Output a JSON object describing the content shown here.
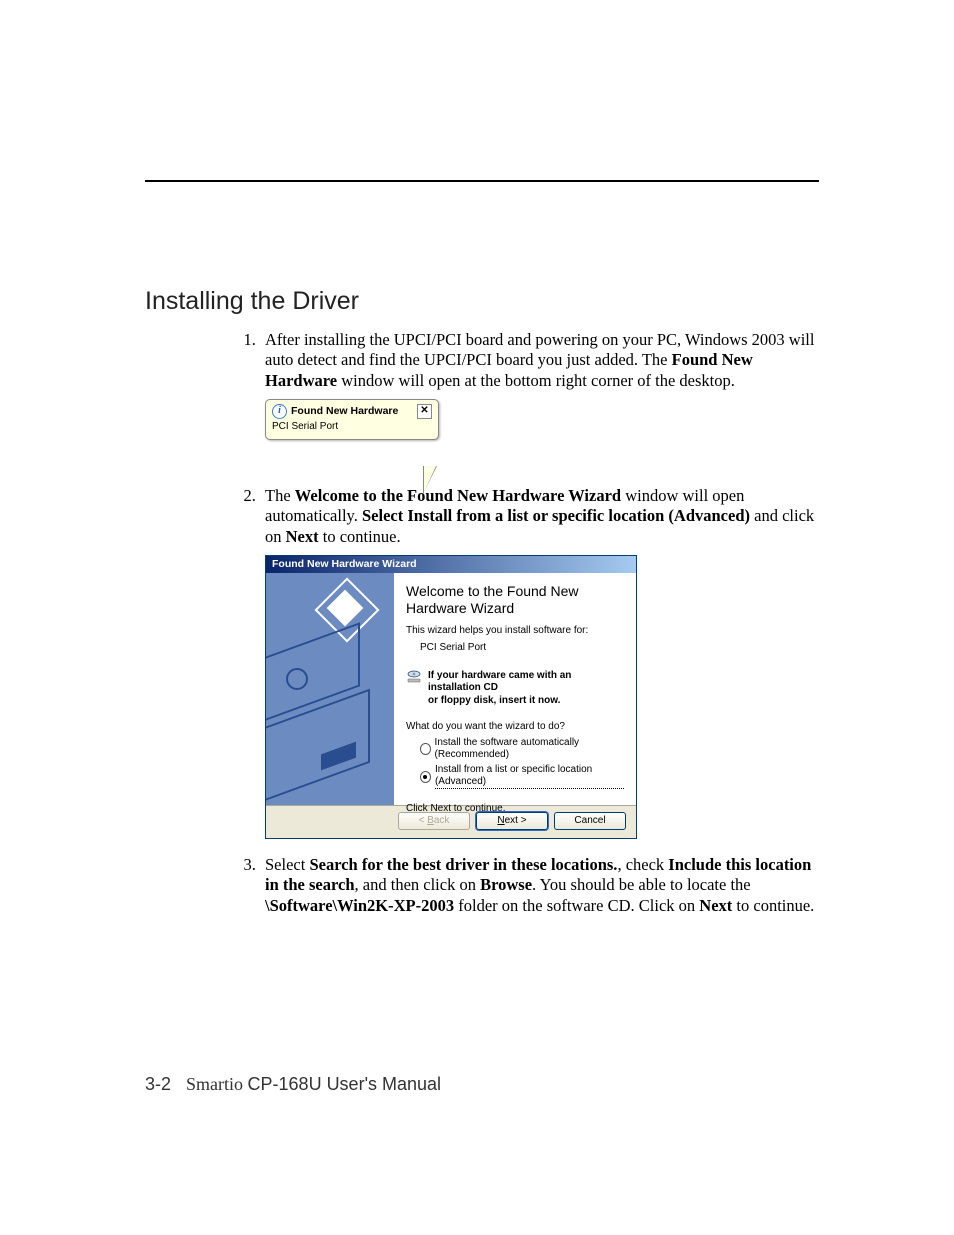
{
  "section_title": "Installing the Driver",
  "steps": {
    "s1": {
      "pre": "After installing the UPCI/PCI board and powering on your PC, Windows 2003 will auto detect and find the UPCI/PCI board you just added. The ",
      "bold1": "Found New Hardware",
      "post": " window will open at the bottom right corner of the desktop."
    },
    "s2": {
      "pre": "The ",
      "bold1": "Welcome to the Found New Hardware Wizard",
      "mid1": " window will open automatically. ",
      "bold2": "Select Install from a list or specific location (Advanced)",
      "mid2": " and click on ",
      "bold3": "Next",
      "post": " to continue."
    },
    "s3": {
      "pre": "Select ",
      "bold1": "Search for the best driver in these locations.",
      "mid1": ", check ",
      "bold2": "Include this location in the search",
      "mid2": ", and then click on ",
      "bold3": "Browse",
      "mid3": ". You should be able to locate the ",
      "bold4": "\\Software\\Win2K-XP-2003",
      "mid4": " folder on the software CD. Click on ",
      "bold5": "Next",
      "post": " to continue."
    }
  },
  "balloon": {
    "title": "Found New Hardware",
    "body": "PCI Serial Port",
    "close": "✕"
  },
  "wizard": {
    "title": "Found New Hardware Wizard",
    "heading": "Welcome to the Found New Hardware Wizard",
    "helps": "This wizard helps you install software for:",
    "device": "PCI Serial Port",
    "cd_line1": "If your hardware came with an installation CD",
    "cd_line2": "or floppy disk, insert it now.",
    "question": "What do you want the wizard to do?",
    "opt1": "Install the software automatically (Recommended)",
    "opt2": "Install from a list or specific location (Advanced)",
    "click_next": "Click Next to continue.",
    "btn_back_lt": "< ",
    "btn_back_b": "B",
    "btn_back_rest": "ack",
    "btn_next_n": "N",
    "btn_next_rest": "ext >",
    "btn_cancel": "Cancel"
  },
  "footer": {
    "page": "3-2",
    "smartio": "Smartio ",
    "manual": "CP-168U User's Manual"
  }
}
